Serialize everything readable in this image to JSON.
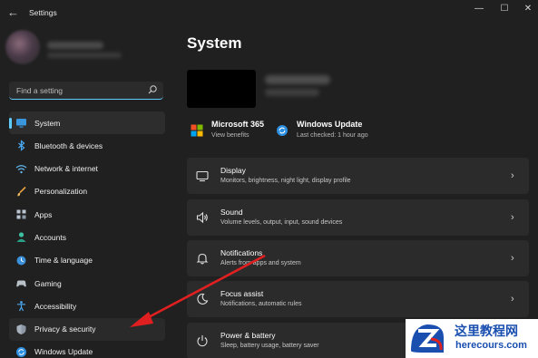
{
  "window": {
    "title": "Settings",
    "controls": [
      "minimize",
      "maximize",
      "close"
    ]
  },
  "sidebar": {
    "search_placeholder": "Find a setting",
    "items": [
      {
        "label": "System",
        "icon": "monitor-icon",
        "active": true
      },
      {
        "label": "Bluetooth & devices",
        "icon": "bluetooth-icon"
      },
      {
        "label": "Network & internet",
        "icon": "wifi-icon"
      },
      {
        "label": "Personalization",
        "icon": "brush-icon"
      },
      {
        "label": "Apps",
        "icon": "apps-icon"
      },
      {
        "label": "Accounts",
        "icon": "person-icon"
      },
      {
        "label": "Time & language",
        "icon": "globe-clock-icon"
      },
      {
        "label": "Gaming",
        "icon": "gamepad-icon"
      },
      {
        "label": "Accessibility",
        "icon": "accessibility-icon"
      },
      {
        "label": "Privacy & security",
        "icon": "shield-icon"
      },
      {
        "label": "Windows Update",
        "icon": "update-icon"
      }
    ]
  },
  "main": {
    "title": "System",
    "quick": [
      {
        "title": "Microsoft 365",
        "subtitle": "View benefits",
        "icon": "microsoft-logo-icon"
      },
      {
        "title": "Windows Update",
        "subtitle": "Last checked: 1 hour ago",
        "icon": "update-icon"
      }
    ],
    "cards": [
      {
        "title": "Display",
        "subtitle": "Monitors, brightness, night light, display profile",
        "icon": "display-icon"
      },
      {
        "title": "Sound",
        "subtitle": "Volume levels, output, input, sound devices",
        "icon": "speaker-icon"
      },
      {
        "title": "Notifications",
        "subtitle": "Alerts from apps and system",
        "icon": "bell-icon"
      },
      {
        "title": "Focus assist",
        "subtitle": "Notifications, automatic rules",
        "icon": "moon-icon"
      },
      {
        "title": "Power & battery",
        "subtitle": "Sleep, battery usage, battery saver",
        "icon": "power-icon"
      }
    ]
  },
  "watermark": {
    "title": "这里教程网",
    "url": "herecours.com"
  },
  "colors": {
    "accent": "#60cdff",
    "background": "#202020",
    "card": "#2b2b2b",
    "annotation_arrow": "#e02020"
  }
}
